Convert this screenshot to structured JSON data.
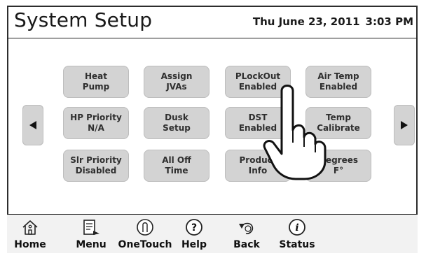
{
  "header": {
    "title": "System Setup",
    "date": "Thu June 23, 2011",
    "time": "3:03 PM"
  },
  "nav": {
    "left_arrow_icon": "left-triangle-icon",
    "right_arrow_icon": "right-triangle-icon"
  },
  "grid": {
    "buttons": [
      {
        "line1": "Heat",
        "line2": "Pump"
      },
      {
        "line1": "Assign",
        "line2": "JVAs"
      },
      {
        "line1": "PLockOut",
        "line2": "Enabled"
      },
      {
        "line1": "Air Temp",
        "line2": "Enabled"
      },
      {
        "line1": "HP Priority",
        "line2": "N/A"
      },
      {
        "line1": "Dusk",
        "line2": "Setup"
      },
      {
        "line1": "DST",
        "line2": "Enabled"
      },
      {
        "line1": "Temp",
        "line2": "Calibrate"
      },
      {
        "line1": "Slr Priority",
        "line2": "Disabled"
      },
      {
        "line1": "All Off",
        "line2": "Time"
      },
      {
        "line1": "Product",
        "line2": "Info"
      },
      {
        "line1": "Degrees",
        "line2": "F°"
      }
    ]
  },
  "toolbar": {
    "items": [
      {
        "label": "Home",
        "icon": "house-icon"
      },
      {
        "label": "Menu",
        "icon": "menu-icon"
      },
      {
        "label": "OneTouch",
        "icon": "touch-button-icon"
      },
      {
        "label": "Help",
        "icon": "help-icon"
      },
      {
        "label": "Back",
        "icon": "back-icon"
      },
      {
        "label": "Status",
        "icon": "info-icon"
      }
    ]
  },
  "overlay": {
    "icon": "pointing-hand-icon"
  }
}
